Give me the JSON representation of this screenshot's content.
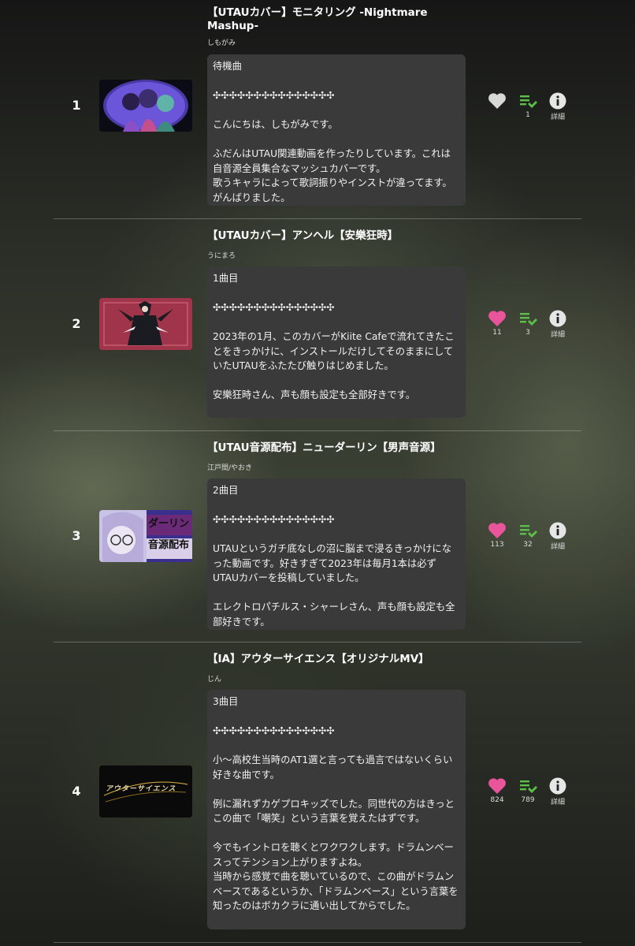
{
  "colors": {
    "liked": "#e8559a",
    "unliked": "#d8d8d8",
    "playlist": "#5ac04a",
    "info": "#e6e6e6"
  },
  "tracks": [
    {
      "rank": "1",
      "title": "【UTAUカバー】モニタリング -Nightmare Mashup-",
      "artist": "しもがみ",
      "comment": "待機曲\n\n✣✣✣✣✣✣✣✣✣✣✣✣✣✣✣\n\nこんにちは、しもがみです。\n\nふだんはUTAU関連動画を作ったりしています。これは自音源全員集合なマッシュカバーです。\n歌うキャラによって歌詞振りやインストが違ってます。がんばりました。",
      "liked": false,
      "likes": "",
      "playlists": "1",
      "info_label": "詳細",
      "thumb_icon": "anime-characters-thumbnail"
    },
    {
      "rank": "2",
      "title": "【UTAUカバー】アンヘル【安樂狂時】",
      "artist": "うにまろ",
      "comment": "1曲目\n\n✣✣✣✣✣✣✣✣✣✣✣✣✣✣✣\n\n2023年の1月、このカバーがKiite Cafeで流れてきたことをきっかけに、インストールだけしてそのままにしていたUTAUをふたたび触りはじめました。\n\n安樂狂時さん、声も顔も設定も全部好きです。",
      "liked": true,
      "likes": "11",
      "playlists": "3",
      "info_label": "詳細",
      "thumb_icon": "dark-figure-thumbnail"
    },
    {
      "rank": "3",
      "title": "【UTAU音源配布】ニューダーリン【男声音源】",
      "artist": "江戸間/やおき",
      "comment": "2曲目\n\n✣✣✣✣✣✣✣✣✣✣✣✣✣✣✣\n\nUTAUというガチ底なしの沼に脳まで浸るきっかけになった動画です。好きすぎて2023年は毎月1本は必ずUTAUカバーを投稿していました。\n\nエレクトロパチルス・シャーレさん、声も顔も設定も全部好きです。",
      "liked": true,
      "likes": "113",
      "playlists": "32",
      "info_label": "詳細",
      "thumb_icon": "character-glasses-thumbnail",
      "thumb_text": "ダーリン\n音源配布"
    },
    {
      "rank": "4",
      "title": "【IA】アウターサイエンス【オリジナルMV】",
      "artist": "じん",
      "comment": "3曲目\n\n✣✣✣✣✣✣✣✣✣✣✣✣✣✣✣\n\n小〜高校生当時のAT1選と言っても過言ではないくらい好きな曲です。\n\n例に漏れずカゲプロキッズでした。同世代の方はきっとこの曲で「嘲笑」という言葉を覚えたはずです。\n\n今でもイントロを聴くとワクワクします。ドラムンベースってテンション上がりますよね。\n当時から感覚で曲を聴いているので、この曲がドラムンベースであるというか、「ドラムンベース」という言葉を知ったのはボカクラに通い出してからでした。",
      "liked": true,
      "likes": "824",
      "playlists": "789",
      "info_label": "詳細",
      "thumb_icon": "logo-text-thumbnail",
      "thumb_text": "アウターサイエンス"
    }
  ]
}
